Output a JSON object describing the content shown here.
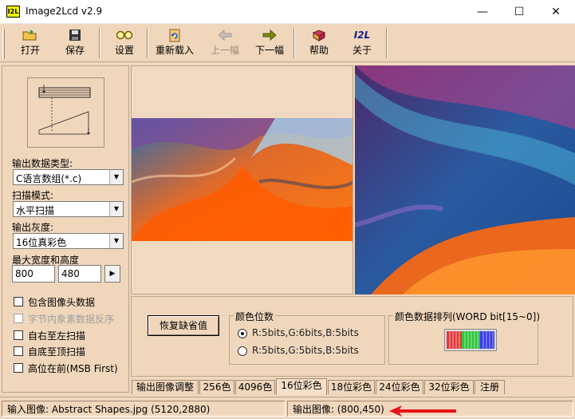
{
  "window": {
    "icon_text": "I2L",
    "title": "Image2Lcd v2.9",
    "controls": {
      "minimize": "—",
      "maximize": "☐",
      "close": "✕"
    }
  },
  "toolbar": {
    "open": {
      "label": "打开",
      "icon": "folder-open-icon"
    },
    "save": {
      "label": "保存",
      "icon": "floppy-disk-icon"
    },
    "settings": {
      "label": "设置",
      "icon": "glasses-icon"
    },
    "reload": {
      "label": "重新载入",
      "icon": "reload-icon"
    },
    "prev": {
      "label": "上一幅",
      "icon": "arrow-left-icon",
      "enabled": false
    },
    "next": {
      "label": "下一幅",
      "icon": "arrow-right-icon"
    },
    "help": {
      "label": "帮助",
      "icon": "help-book-icon"
    },
    "about": {
      "label": "关于",
      "icon": "i2l-logo-icon",
      "logo_text": "I2L"
    }
  },
  "left_panel": {
    "output_type": {
      "label": "输出数据类型:",
      "value": "C语言数组(*.c)"
    },
    "scan_mode": {
      "label": "扫描模式:",
      "value": "水平扫描"
    },
    "grayscale": {
      "label": "输出灰度:",
      "value": "16位真彩色"
    },
    "max_size": {
      "label": "最大宽度和高度",
      "width": "800",
      "height": "480",
      "apply_symbol": "▶"
    },
    "options": [
      {
        "label": "包含图像头数据",
        "checked": false,
        "enabled": true
      },
      {
        "label": "字节内象素数据反序",
        "checked": false,
        "enabled": false
      },
      {
        "label": "自右至左扫描",
        "checked": false,
        "enabled": true
      },
      {
        "label": "自底至顶扫描",
        "checked": false,
        "enabled": true
      },
      {
        "label": "高位在前(MSB First)",
        "checked": false,
        "enabled": true
      }
    ]
  },
  "settings": {
    "restore_button": "恢复缺省值",
    "color_bits": {
      "title": "颜色位数",
      "options": [
        {
          "label": "R:5bits,G:6bits,B:5bits",
          "selected": true
        },
        {
          "label": "R:5bits,G:5bits,B:5bits",
          "selected": false
        }
      ]
    },
    "color_order": {
      "title": "颜色数据排列(WORD bit[15~0])"
    }
  },
  "tabs": [
    {
      "label": "输出图像调整",
      "active": false
    },
    {
      "label": "256色",
      "active": false
    },
    {
      "label": "4096色",
      "active": false
    },
    {
      "label": "16位彩色",
      "active": true
    },
    {
      "label": "18位彩色",
      "active": false
    },
    {
      "label": "24位彩色",
      "active": false
    },
    {
      "label": "32位彩色",
      "active": false
    },
    {
      "label": "注册",
      "active": false
    }
  ],
  "status": {
    "input_label": "输入图像:",
    "input_value": "Abstract Shapes.jpg (5120,2880)",
    "output_label": "输出图像:",
    "output_value": "(800,450)"
  },
  "colors": {
    "annotation_arrow": "#e8141b",
    "bit_red": "#e23a3a",
    "bit_green": "#2fc43a",
    "bit_blue": "#3a3ae8"
  }
}
